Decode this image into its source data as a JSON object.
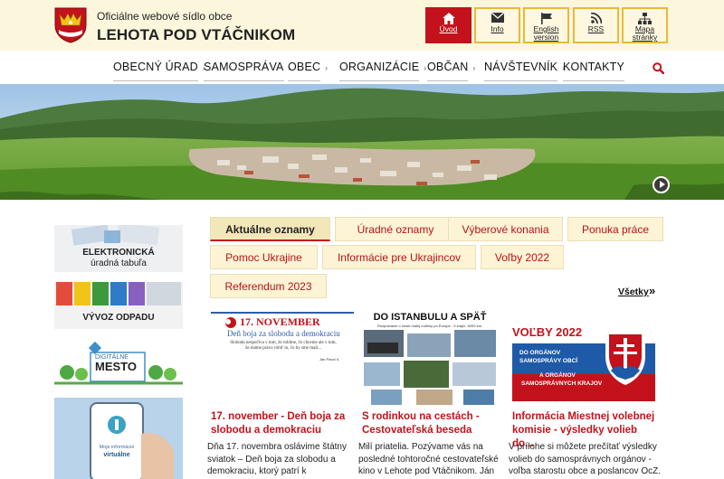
{
  "header": {
    "subtitle": "Oficiálne webové sídlo obce",
    "site_name": "LEHOTA POD VTÁČNIKOM"
  },
  "quick_links": [
    {
      "label": "Úvod",
      "icon": "home-icon"
    },
    {
      "label": "Info",
      "icon": "envelope-icon"
    },
    {
      "label": "English version",
      "icon": "flag-icon"
    },
    {
      "label": "RSS",
      "icon": "rss-icon"
    },
    {
      "label": "Mapa stránky",
      "icon": "sitemap-icon"
    }
  ],
  "nav": {
    "items": [
      "OBECNÝ ÚRAD",
      "SAMOSPRÁVA",
      "OBEC",
      "ORGANIZÁCIE",
      "OBČAN",
      "NÁVŠTEVNÍK",
      "KONTAKTY"
    ]
  },
  "sidebar": {
    "banners": [
      {
        "line1": "ELEKTRONICKÁ",
        "line2": "úradná tabuľa"
      },
      {
        "line1": "VÝVOZ ODPADU"
      },
      {
        "line1": "DIGITÁLNE",
        "line2": "MESTO"
      },
      {
        "line1": "Moje informácie",
        "line2": "virtuálne"
      }
    ]
  },
  "tabs": [
    "Aktuálne oznamy",
    "Úradné oznamy",
    "Výberové konania",
    "Ponuka práce",
    "Pomoc Ukrajine",
    "Informácie pre Ukrajincov",
    "Voľby 2022",
    "Referendum 2023"
  ],
  "all_link": "Všetky",
  "all_arrow": "»",
  "articles": [
    {
      "title": "17. november - Deň boja za slobodu a demokraciu",
      "excerpt": "Dňa 17. novembra oslávime štátny sviatok – Deň boja za slobodu a demokraciu, ktorý patrí k",
      "thumb": {
        "date": "17. NOVEMBER",
        "subtitle": "Deň boja za slobodu a demokraciu",
        "body": "Sloboda nespočíva v tom, že robíme, čo chceme ale v tom, že máme právo robiť to, čo by sme mali...",
        "author": "Ján Pavol II."
      }
    },
    {
      "title": "S rodinkou na cestách - Cestovateľská beseda",
      "excerpt": "Milí priatelia. Pozývame vás na posledné tohtoročné cestovateľské kino v Lehote pod Vtáčnikom. Ján",
      "thumb": {
        "heading": "DO ISTANBULU A SPÄŤ",
        "sub": "Rozprávanie o ceste malej rodinky po Európe - 9 krajín, 6000 km."
      }
    },
    {
      "title": "Informácia Miestnej volebnej komisie - výsledky volieb do...",
      "excerpt": "V prílohe si môžete prečítať výsledky volieb do samosprávnych orgánov - voľba starostu obce a poslancov OcZ.",
      "thumb": {
        "heading": "VOĽBY 2022",
        "line1": "DO ORGÁNOV",
        "line2": "SAMOSPRÁVY OBCÍ",
        "line3": "A ORGÁNOV",
        "line4": "SAMOSPRÁVNYCH KRAJOV"
      }
    }
  ],
  "colors": {
    "accent": "#c3121b",
    "header_bg": "#fbf6dc",
    "tab_bg": "#fcf4d4",
    "tab_border": "#e9b93b"
  }
}
